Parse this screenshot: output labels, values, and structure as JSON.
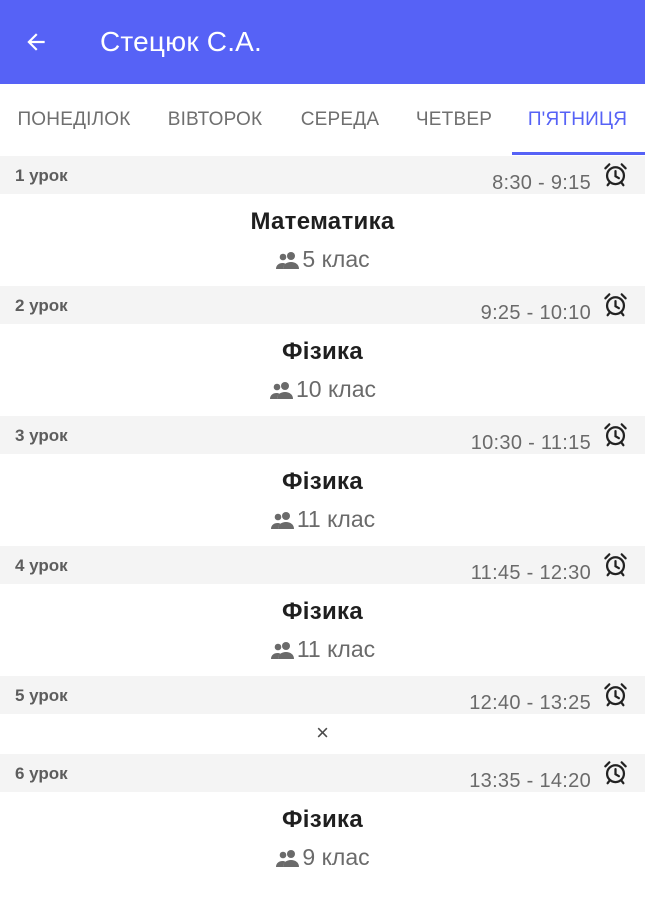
{
  "header": {
    "title": "Стецюк С.А.",
    "back_icon": "arrow-left-icon",
    "background": "#5662f6"
  },
  "tabs": [
    {
      "label": "ПОНЕДІЛОК",
      "active": false
    },
    {
      "label": "ВІВТОРОК",
      "active": false
    },
    {
      "label": "СЕРЕДА",
      "active": false
    },
    {
      "label": "ЧЕТВЕР",
      "active": false
    },
    {
      "label": "П'ЯТНИЦЯ",
      "active": true
    }
  ],
  "accent_color": "#5662f6",
  "lessons": [
    {
      "number": "1 урок",
      "time": "8:30 - 9:15",
      "subject": "Математика",
      "class": "5 клас"
    },
    {
      "number": "2 урок",
      "time": "9:25 - 10:10",
      "subject": "Фізика",
      "class": "10 клас"
    },
    {
      "number": "3 урок",
      "time": "10:30 - 11:15",
      "subject": "Фізика",
      "class": "11 клас"
    },
    {
      "number": "4 урок",
      "time": "11:45 - 12:30",
      "subject": "Фізика",
      "class": "11 клас"
    },
    {
      "number": "5 урок",
      "time": "12:40 - 13:25",
      "empty": "×"
    },
    {
      "number": "6 урок",
      "time": "13:35 - 14:20",
      "subject": "Фізика",
      "class": "9 клас"
    }
  ]
}
